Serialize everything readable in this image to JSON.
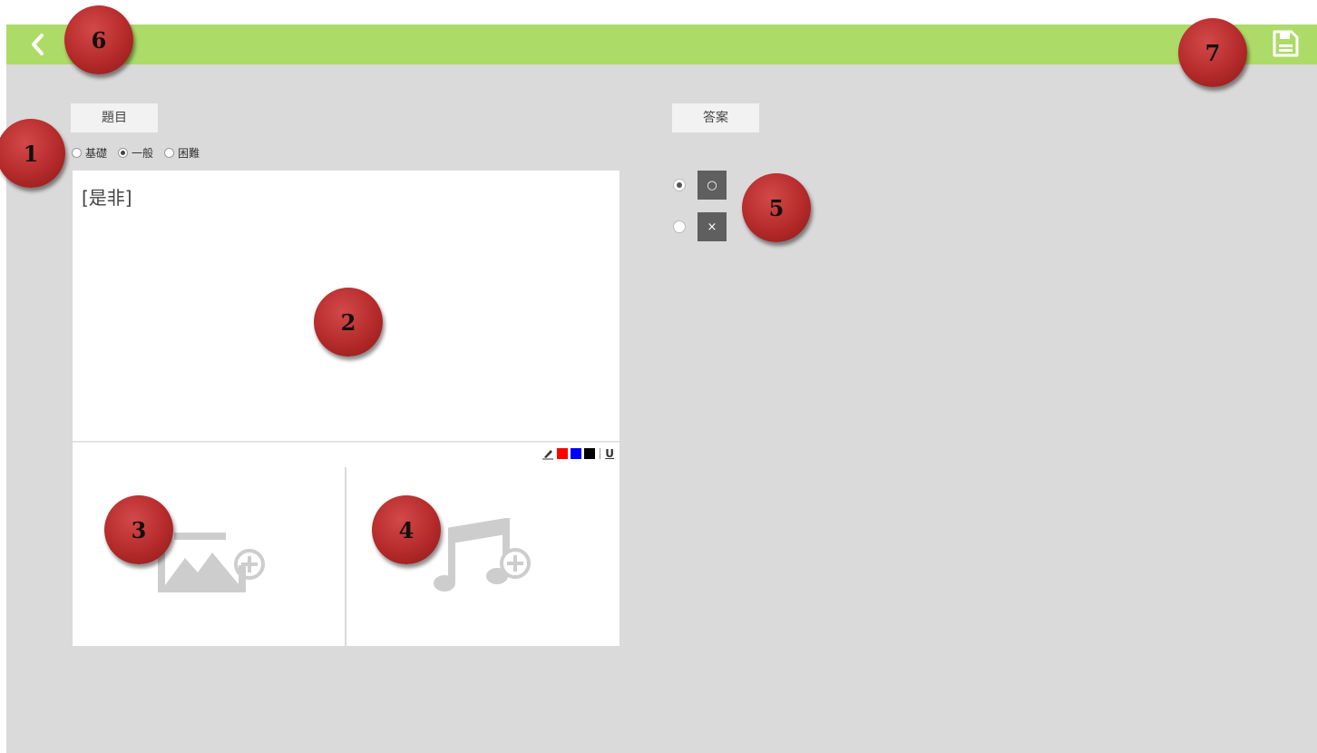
{
  "header": {
    "back_icon": "chevron-left-icon",
    "save_icon": "floppy-disk-icon",
    "bar_color": "#addb68"
  },
  "question_panel": {
    "tab_label": "題目",
    "difficulty": {
      "options": [
        "基礎",
        "一般",
        "困難"
      ],
      "selected": "一般"
    },
    "text": "[是非]",
    "toolbar": {
      "pencil_icon": "pencil-icon",
      "colors": [
        "#ff0000",
        "#0000ff",
        "#000000"
      ],
      "underline_label": "U"
    },
    "add_image_icon": "add-image-icon",
    "add_audio_icon": "add-audio-icon"
  },
  "answer_panel": {
    "tab_label": "答案",
    "options": [
      {
        "label": "○",
        "selected": true
      },
      {
        "label": "×",
        "selected": false
      }
    ]
  },
  "callouts": [
    "1",
    "2",
    "3",
    "4",
    "5",
    "6",
    "7"
  ]
}
